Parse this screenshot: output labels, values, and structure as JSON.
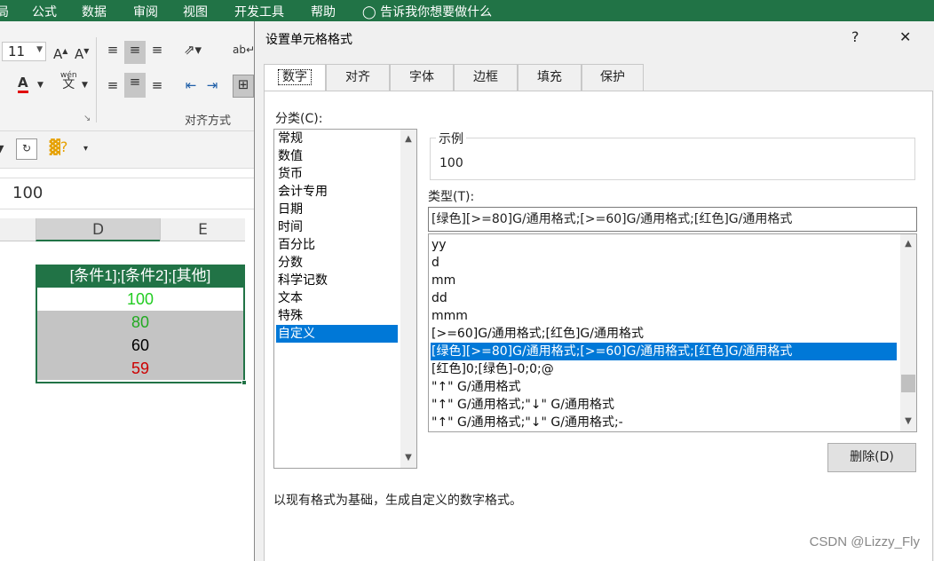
{
  "menu": [
    "局",
    "公式",
    "数据",
    "审阅",
    "视图",
    "开发工具",
    "帮助"
  ],
  "tellme": "告诉我你想要做什么",
  "ribbon": {
    "font_size": "11",
    "align_group_label": "对齐方式",
    "wen_glyph": "wén",
    "wen_char": "文"
  },
  "formula_value": "100",
  "columns": [
    "D",
    "E"
  ],
  "cells": {
    "header": "[条件1];[条件2];[其他]",
    "values": [
      "100",
      "80",
      "60",
      "59"
    ],
    "colors": [
      "#22cc22",
      "#22aa22",
      "#000000",
      "#cc0000"
    ]
  },
  "dialog": {
    "title": "设置单元格格式",
    "help": "?",
    "close": "✕",
    "tabs": [
      "数字",
      "对齐",
      "字体",
      "边框",
      "填充",
      "保护"
    ],
    "category_label": "分类(C):",
    "categories": [
      "常规",
      "数值",
      "货币",
      "会计专用",
      "日期",
      "时间",
      "百分比",
      "分数",
      "科学记数",
      "文本",
      "特殊",
      "自定义"
    ],
    "selected_category": "自定义",
    "sample_label": "示例",
    "sample_value": "100",
    "type_label": "类型(T):",
    "type_value": "[绿色][>=80]G/通用格式;[>=60]G/通用格式;[红色]G/通用格式",
    "formats": [
      "yy",
      "d",
      "mm",
      "dd",
      "mmm",
      "[>=60]G/通用格式;[红色]G/通用格式",
      "[绿色][>=80]G/通用格式;[>=60]G/通用格式;[红色]G/通用格式",
      "[红色]0;[绿色]-0;0;@",
      "\"↑\" G/通用格式",
      "\"↑\" G/通用格式;\"↓\" G/通用格式",
      "\"↑\" G/通用格式;\"↓\" G/通用格式;-"
    ],
    "delete_button": "删除(D)",
    "description": "以现有格式为基础，生成自定义的数字格式。"
  },
  "watermark": "CSDN @Lizzy_Fly"
}
